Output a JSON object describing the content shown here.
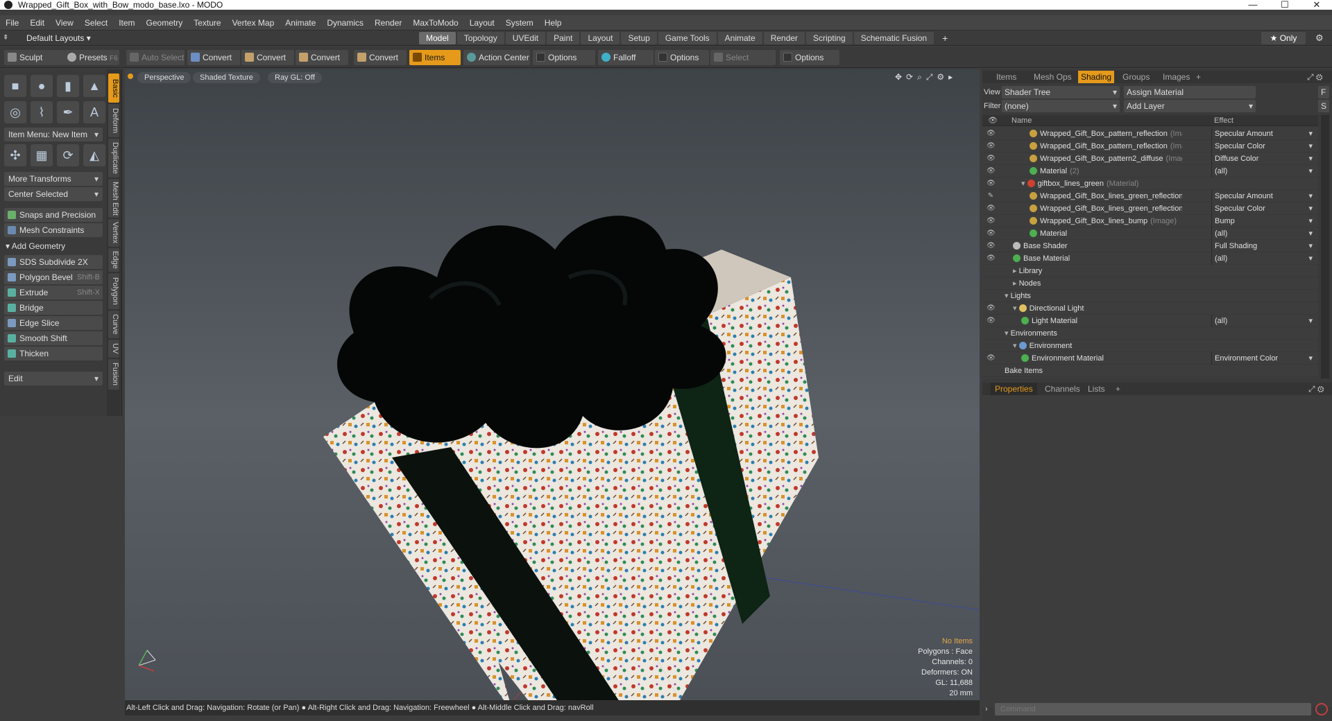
{
  "window": {
    "title": "Wrapped_Gift_Box_with_Bow_modo_base.lxo - MODO",
    "minimize": "—",
    "maximize": "☐",
    "close": "✕"
  },
  "menu": [
    "File",
    "Edit",
    "View",
    "Select",
    "Item",
    "Geometry",
    "Texture",
    "Vertex Map",
    "Animate",
    "Dynamics",
    "Render",
    "MaxToModo",
    "Layout",
    "System",
    "Help"
  ],
  "layoutbar": {
    "layouts_label": "Default Layouts ▾",
    "tabs": [
      "Model",
      "Topology",
      "UVEdit",
      "Paint",
      "Layout",
      "Setup",
      "Game Tools",
      "Animate",
      "Render",
      "Scripting",
      "Schematic Fusion"
    ],
    "active_tab": "Model",
    "add": "+",
    "only": "★ Only"
  },
  "toolbar": {
    "sculpt": "Sculpt",
    "presets": "Presets",
    "presets_key": "F6",
    "auto_select": "Auto Select",
    "convert1": "Convert",
    "convert2": "Convert",
    "convert3": "Convert",
    "convert4": "Convert",
    "items": "Items",
    "action_center": "Action Center",
    "options1": "Options",
    "falloff": "Falloff",
    "options2": "Options",
    "select_through": "Select Through",
    "options3": "Options"
  },
  "leftpanel": {
    "item_menu": "Item Menu: New Item",
    "more_transforms": "More Transforms",
    "center_selected": "Center Selected",
    "snaps": "Snaps and Precision",
    "mesh_constraints": "Mesh Constraints",
    "add_geometry": "Add Geometry",
    "tools": [
      {
        "label": "SDS Subdivide 2X",
        "key": ""
      },
      {
        "label": "Polygon Bevel",
        "key": "Shift-B"
      },
      {
        "label": "Extrude",
        "key": "Shift-X"
      },
      {
        "label": "Bridge",
        "key": ""
      },
      {
        "label": "Edge Slice",
        "key": ""
      },
      {
        "label": "Smooth Shift",
        "key": ""
      },
      {
        "label": "Thicken",
        "key": ""
      }
    ],
    "edit": "Edit",
    "vtabs": [
      "Basic",
      "Deform",
      "Duplicate",
      "Mesh Edit",
      "Vertex",
      "Edge",
      "Polygon",
      "Curve",
      "UV",
      "Fusion"
    ]
  },
  "viewport": {
    "perspective": "Perspective",
    "shaded": "Shaded Texture",
    "raygl": "Ray GL: Off",
    "hud": {
      "items": "No Items",
      "polygons": "Polygons : Face",
      "channels": "Channels: 0",
      "deformers": "Deformers: ON",
      "gl": "GL: 11,688",
      "scale": "20 mm"
    }
  },
  "status": "Alt-Left Click and Drag: Navigation: Rotate (or Pan) ● Alt-Right Click and Drag: Navigation: Freewheel ● Alt-Middle Click and Drag: navRoll",
  "rightpanel": {
    "tabs": [
      "Items",
      "Mesh Ops",
      "Shading",
      "Groups",
      "Images",
      "+"
    ],
    "active_tab": "Shading",
    "view_label": "View",
    "view_value": "Shader Tree",
    "assign": "Assign Material",
    "f_btn": "F",
    "filter_label": "Filter",
    "filter_value": "(none)",
    "add_layer": "Add Layer",
    "s_btn": "S",
    "col_name": "Name",
    "col_effect": "Effect",
    "rows": [
      {
        "name": "Wrapped_Gift_Box_pattern_reflection",
        "sub": "(Ima...",
        "effect": "Specular Amount",
        "indent": 60,
        "icon": "#c8a040",
        "eye": "👁"
      },
      {
        "name": "Wrapped_Gift_Box_pattern_reflection",
        "sub": "(Ima...",
        "effect": "Specular Color",
        "indent": 60,
        "icon": "#c8a040",
        "eye": "👁"
      },
      {
        "name": "Wrapped_Gift_Box_pattern2_diffuse",
        "sub": "(Image)",
        "effect": "Diffuse Color",
        "indent": 60,
        "icon": "#c8a040",
        "eye": "👁"
      },
      {
        "name": "Material",
        "sub": "(2)",
        "effect": "(all)",
        "indent": 60,
        "icon": "#4caf50",
        "eye": "👁"
      },
      {
        "name": "giftbox_lines_green",
        "sub": "(Material)",
        "effect": "",
        "indent": 48,
        "icon": "#d04030",
        "eye": "👁"
      },
      {
        "name": "Wrapped_Gift_Box_lines_green_reflection",
        "sub": "(...",
        "effect": "Specular Amount",
        "indent": 60,
        "icon": "#c8a040",
        "eye": "✎"
      },
      {
        "name": "Wrapped_Gift_Box_lines_green_reflection",
        "sub": "(...",
        "effect": "Specular Color",
        "indent": 60,
        "icon": "#c8a040",
        "eye": "👁"
      },
      {
        "name": "Wrapped_Gift_Box_lines_bump",
        "sub": "(Image)",
        "effect": "Bump",
        "indent": 60,
        "icon": "#c8a040",
        "eye": "👁"
      },
      {
        "name": "Material",
        "sub": "",
        "effect": "(all)",
        "indent": 60,
        "icon": "#4caf50",
        "eye": "👁"
      },
      {
        "name": "Base Shader",
        "sub": "",
        "effect": "Full Shading",
        "indent": 36,
        "icon": "#bbbbbb",
        "eye": "👁"
      },
      {
        "name": "Base Material",
        "sub": "",
        "effect": "(all)",
        "indent": 36,
        "icon": "#4caf50",
        "eye": "👁"
      },
      {
        "name": "Library",
        "sub": "",
        "effect": "",
        "indent": 36,
        "icon": "",
        "eye": ""
      },
      {
        "name": "Nodes",
        "sub": "",
        "effect": "",
        "indent": 36,
        "icon": "",
        "eye": ""
      },
      {
        "name": "Lights",
        "sub": "",
        "effect": "",
        "indent": 24,
        "icon": "",
        "eye": ""
      },
      {
        "name": "Directional Light",
        "sub": "",
        "effect": "",
        "indent": 36,
        "icon": "#e0c060",
        "eye": "👁"
      },
      {
        "name": "Light Material",
        "sub": "",
        "effect": "(all)",
        "indent": 48,
        "icon": "#4caf50",
        "eye": "👁"
      },
      {
        "name": "Environments",
        "sub": "",
        "effect": "",
        "indent": 24,
        "icon": "",
        "eye": ""
      },
      {
        "name": "Environment",
        "sub": "",
        "effect": "",
        "indent": 36,
        "icon": "#6a9ad0",
        "eye": ""
      },
      {
        "name": "Environment Material",
        "sub": "",
        "effect": "Environment Color",
        "indent": 48,
        "icon": "#4caf50",
        "eye": "👁"
      },
      {
        "name": "Bake Items",
        "sub": "",
        "effect": "",
        "indent": 24,
        "icon": "",
        "eye": ""
      }
    ],
    "ptabs": [
      "Properties",
      "Channels",
      "Lists",
      "+"
    ],
    "command_placeholder": "Command"
  }
}
